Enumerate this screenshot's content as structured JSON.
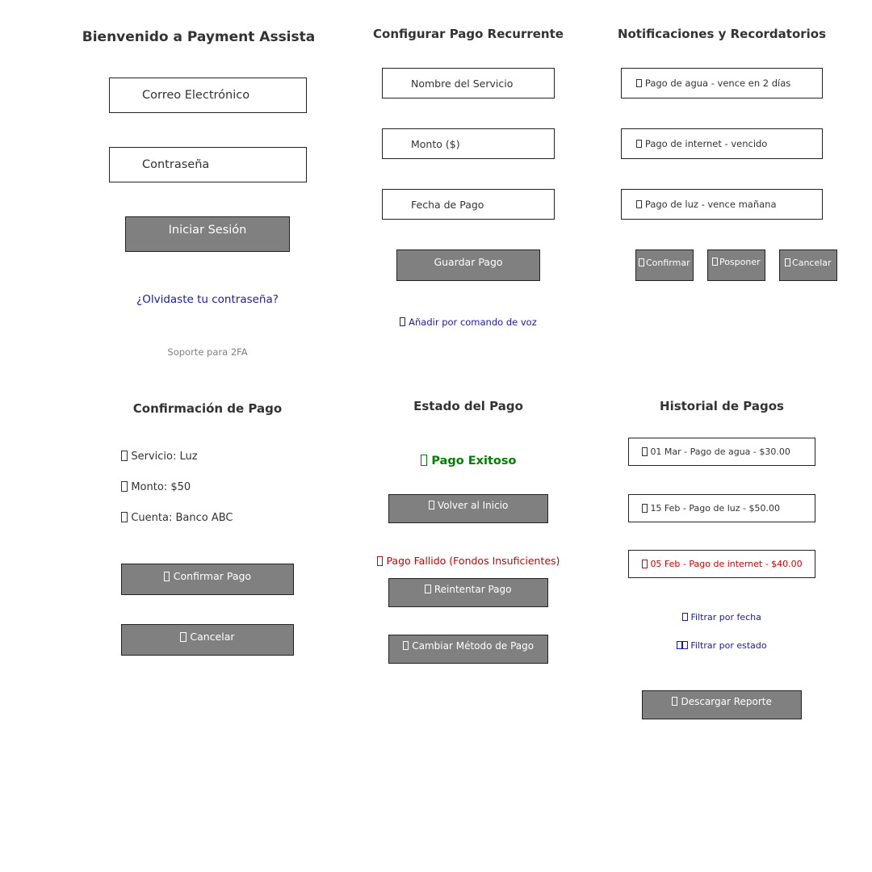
{
  "login": {
    "title": "Bienvenido a Payment Assista",
    "email_placeholder": "Correo Electrónico",
    "password_placeholder": "Contraseña",
    "login_button": "Iniciar Sesión",
    "forgot_link": "¿Olvidaste tu contraseña?",
    "twofa_note": "Soporte para 2FA"
  },
  "recurring": {
    "title": "Configurar Pago Recurrente",
    "service_placeholder": "Nombre del Servicio",
    "amount_placeholder": "Monto ($)",
    "date_placeholder": "Fecha de Pago",
    "save_button": "Guardar Pago",
    "voice_link": "Añadir por comando de voz",
    "voice_icon": "microphone-icon"
  },
  "notifications": {
    "title": "Notificaciones y Recordatorios",
    "items": [
      {
        "text": "Pago de agua - vence en 2 días",
        "icon": "droplet-icon"
      },
      {
        "text": "Pago de internet - vencido",
        "icon": "warning-icon"
      },
      {
        "text": "Pago de luz - vence mañana",
        "icon": "lightbulb-icon"
      }
    ],
    "confirm_button": "Confirmar",
    "postpone_button": "Posponer",
    "cancel_button": "Cancelar"
  },
  "confirmation": {
    "title": "Confirmación de Pago",
    "service": "Servicio: Luz",
    "amount": "Monto: $50",
    "account": "Cuenta: Banco ABC",
    "confirm_button": "Confirmar Pago",
    "cancel_button": "Cancelar"
  },
  "status": {
    "title": "Estado del Pago",
    "success_text": "Pago Exitoso",
    "home_button": "Volver al Inicio",
    "failed_text": "Pago Fallido (Fondos Insuficientes)",
    "retry_button": "Reintentar Pago",
    "change_method_button": "Cambiar Método de Pago"
  },
  "history": {
    "title": "Historial de Pagos",
    "items": [
      {
        "text": "01 Mar - Pago de agua - $30.00",
        "status": "ok"
      },
      {
        "text": "15 Feb - Pago de luz - $50.00",
        "status": "ok"
      },
      {
        "text": "05 Feb - Pago de internet - $40.00",
        "status": "failed"
      }
    ],
    "filter_date_link": "Filtrar por fecha",
    "filter_status_link": "Filtrar por estado",
    "download_button": "Descargar Reporte"
  },
  "colors": {
    "button_bg": "#808080",
    "link": "#1a1aa6",
    "success": "#008000",
    "error": "#cc0000",
    "muted": "#808080"
  }
}
